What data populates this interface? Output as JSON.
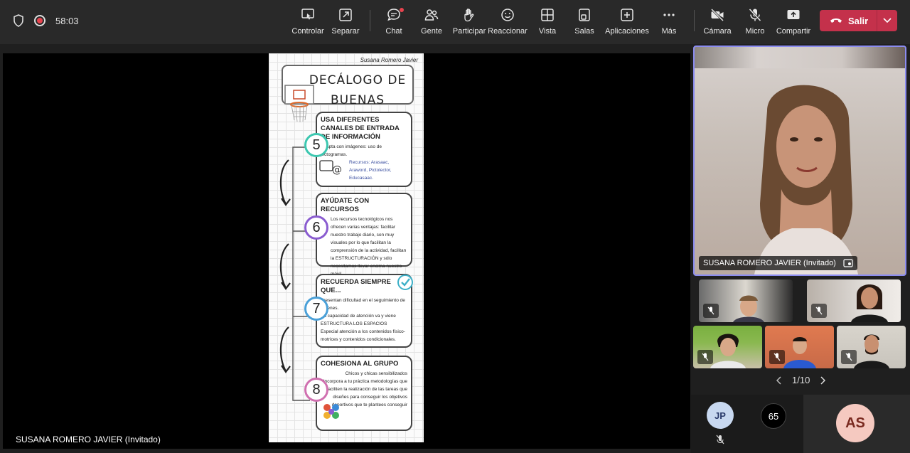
{
  "topbar": {
    "timer": "58:03",
    "buttons": [
      {
        "id": "controlar",
        "label": "Controlar"
      },
      {
        "id": "separar",
        "label": "Separar"
      },
      {
        "id": "chat",
        "label": "Chat"
      },
      {
        "id": "gente",
        "label": "Gente"
      },
      {
        "id": "participar",
        "label": "Participar"
      },
      {
        "id": "reaccionar",
        "label": "Reaccionar"
      },
      {
        "id": "vista",
        "label": "Vista"
      },
      {
        "id": "salas",
        "label": "Salas"
      },
      {
        "id": "aplicaciones",
        "label": "Aplicaciones"
      },
      {
        "id": "mas",
        "label": "Más"
      },
      {
        "id": "camara",
        "label": "Cámara"
      },
      {
        "id": "micro",
        "label": "Micro"
      },
      {
        "id": "compartir",
        "label": "Compartir"
      }
    ],
    "leave_label": "Salir"
  },
  "stage": {
    "presenter_name": "SUSANA ROMERO JAVIER (Invitado)",
    "slide": {
      "author": "Susana Romero Javier",
      "title": "DECÁLOGO DE BUENAS PRÁCTICAS",
      "items": [
        {
          "number": "5",
          "color": "#3cc7b0",
          "heading": "USA DIFERENTES CANALES DE ENTRADA DE INFORMACIÓN",
          "lines": [
            "Adapta con imágenes: uso de pictogramas.",
            "Recursos: Arasaac, Araword, Pictolector, Educasaac."
          ]
        },
        {
          "number": "6",
          "color": "#8a5cd0",
          "heading": "AYÚDATE CON RECURSOS",
          "lines": [
            "Los recursos tecnológicos nos ofrecen varias ventajas: facilitar nuestro trabajo diario, son muy visuales por lo que facilitan la comprensión de la actividad, facilitan la ESTRUCTURACIÓN y sólo necesitamos llevar encima nuestro móvil"
          ]
        },
        {
          "number": "7",
          "color": "#4aa0d8",
          "heading": "RECUERDA SIEMPRE QUE...",
          "lines": [
            "Presentan dificultad en el seguimiento de órdenes.",
            "Su capacidad de atención va y viene",
            "ESTRUCTURA LOS ESPACIOS",
            "Especial atención a los contenidos físico-motrices y contenidos condicionales."
          ]
        },
        {
          "number": "8",
          "color": "#d070b0",
          "heading": "COHESIONA AL GRUPO",
          "lines": [
            "Chicos y chicas sensibilizados",
            "Incorpora a tu práctica metodologías que faciliten la realización de las tareas que diseñes para conseguir los objetivos deportivos que te plantees conseguir"
          ]
        }
      ]
    }
  },
  "side": {
    "main_participant": "SUSANA ROMERO JAVIER (Invitado)",
    "pager": "1/10",
    "avatars": [
      {
        "initials": "JP",
        "bg": "#c8d8f0",
        "fg": "#2a3a6a"
      },
      {
        "count": "65"
      },
      {
        "initials": "AS",
        "bg": "#f5c9c0",
        "fg": "#7a2a20"
      }
    ]
  },
  "colors": {
    "accent": "#8b8cf0",
    "leave": "#c4314b"
  }
}
